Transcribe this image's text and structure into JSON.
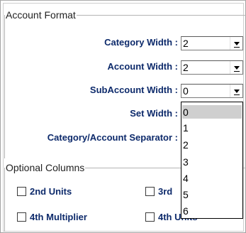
{
  "account_format": {
    "legend": "Account Format",
    "rows": [
      {
        "label": "Category Width :",
        "value": "2"
      },
      {
        "label": "Account Width :",
        "value": "2"
      },
      {
        "label": "SubAccount Width :",
        "value": "0"
      },
      {
        "label": "Set Width :"
      },
      {
        "label": "Category/Account Separator :"
      }
    ]
  },
  "dropdown": {
    "options": [
      "0",
      "1",
      "2",
      "3",
      "4",
      "5",
      "6"
    ],
    "selected": "0"
  },
  "optional_columns": {
    "legend": "Optional Columns",
    "checkboxes": [
      {
        "label": "2nd Units",
        "checked": false
      },
      {
        "label": "3rd",
        "checked": false
      },
      {
        "label": "4th Multiplier",
        "checked": false
      },
      {
        "label": "4th Units",
        "checked": false
      }
    ]
  }
}
